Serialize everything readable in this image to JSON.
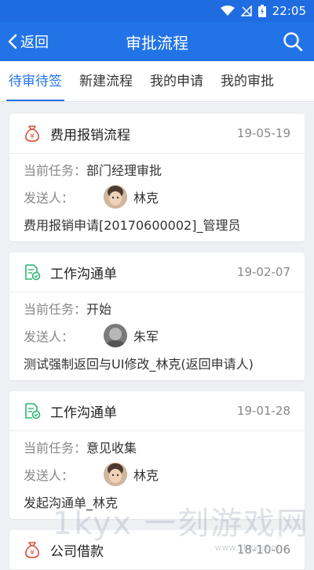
{
  "status_bar": {
    "time": "22:05"
  },
  "header": {
    "back_label": "返回",
    "title": "审批流程"
  },
  "tabs": [
    {
      "label": "待审待签"
    },
    {
      "label": "新建流程"
    },
    {
      "label": "我的申请"
    },
    {
      "label": "我的审批"
    }
  ],
  "labels": {
    "current_task": "当前任务：",
    "sender": "发送人："
  },
  "items": [
    {
      "icon": "money-bag-icon",
      "title": "费用报销流程",
      "date": "19-05-19",
      "task": "部门经理审批",
      "sender": "林克",
      "desc": "费用报销申请[20170600002]_管理员"
    },
    {
      "icon": "document-check-icon",
      "title": "工作沟通单",
      "date": "19-02-07",
      "task": "开始",
      "sender": "朱军",
      "desc": "测试强制返回与UI修改_林克(返回申请人)"
    },
    {
      "icon": "document-check-icon",
      "title": "工作沟通单",
      "date": "19-01-28",
      "task": "意见收集",
      "sender": "林克",
      "desc": "发起沟通单_林克"
    },
    {
      "icon": "money-bag-icon",
      "title": "公司借款",
      "date": "18-10-06"
    }
  ],
  "watermark": {
    "text": "1kyx 一刻游戏网",
    "url": "www.1kyx.com"
  },
  "colors": {
    "primary": "#2274e6",
    "status_bar": "#1f6ce0",
    "money_icon": "#e0503a",
    "doc_icon": "#2bb673"
  }
}
